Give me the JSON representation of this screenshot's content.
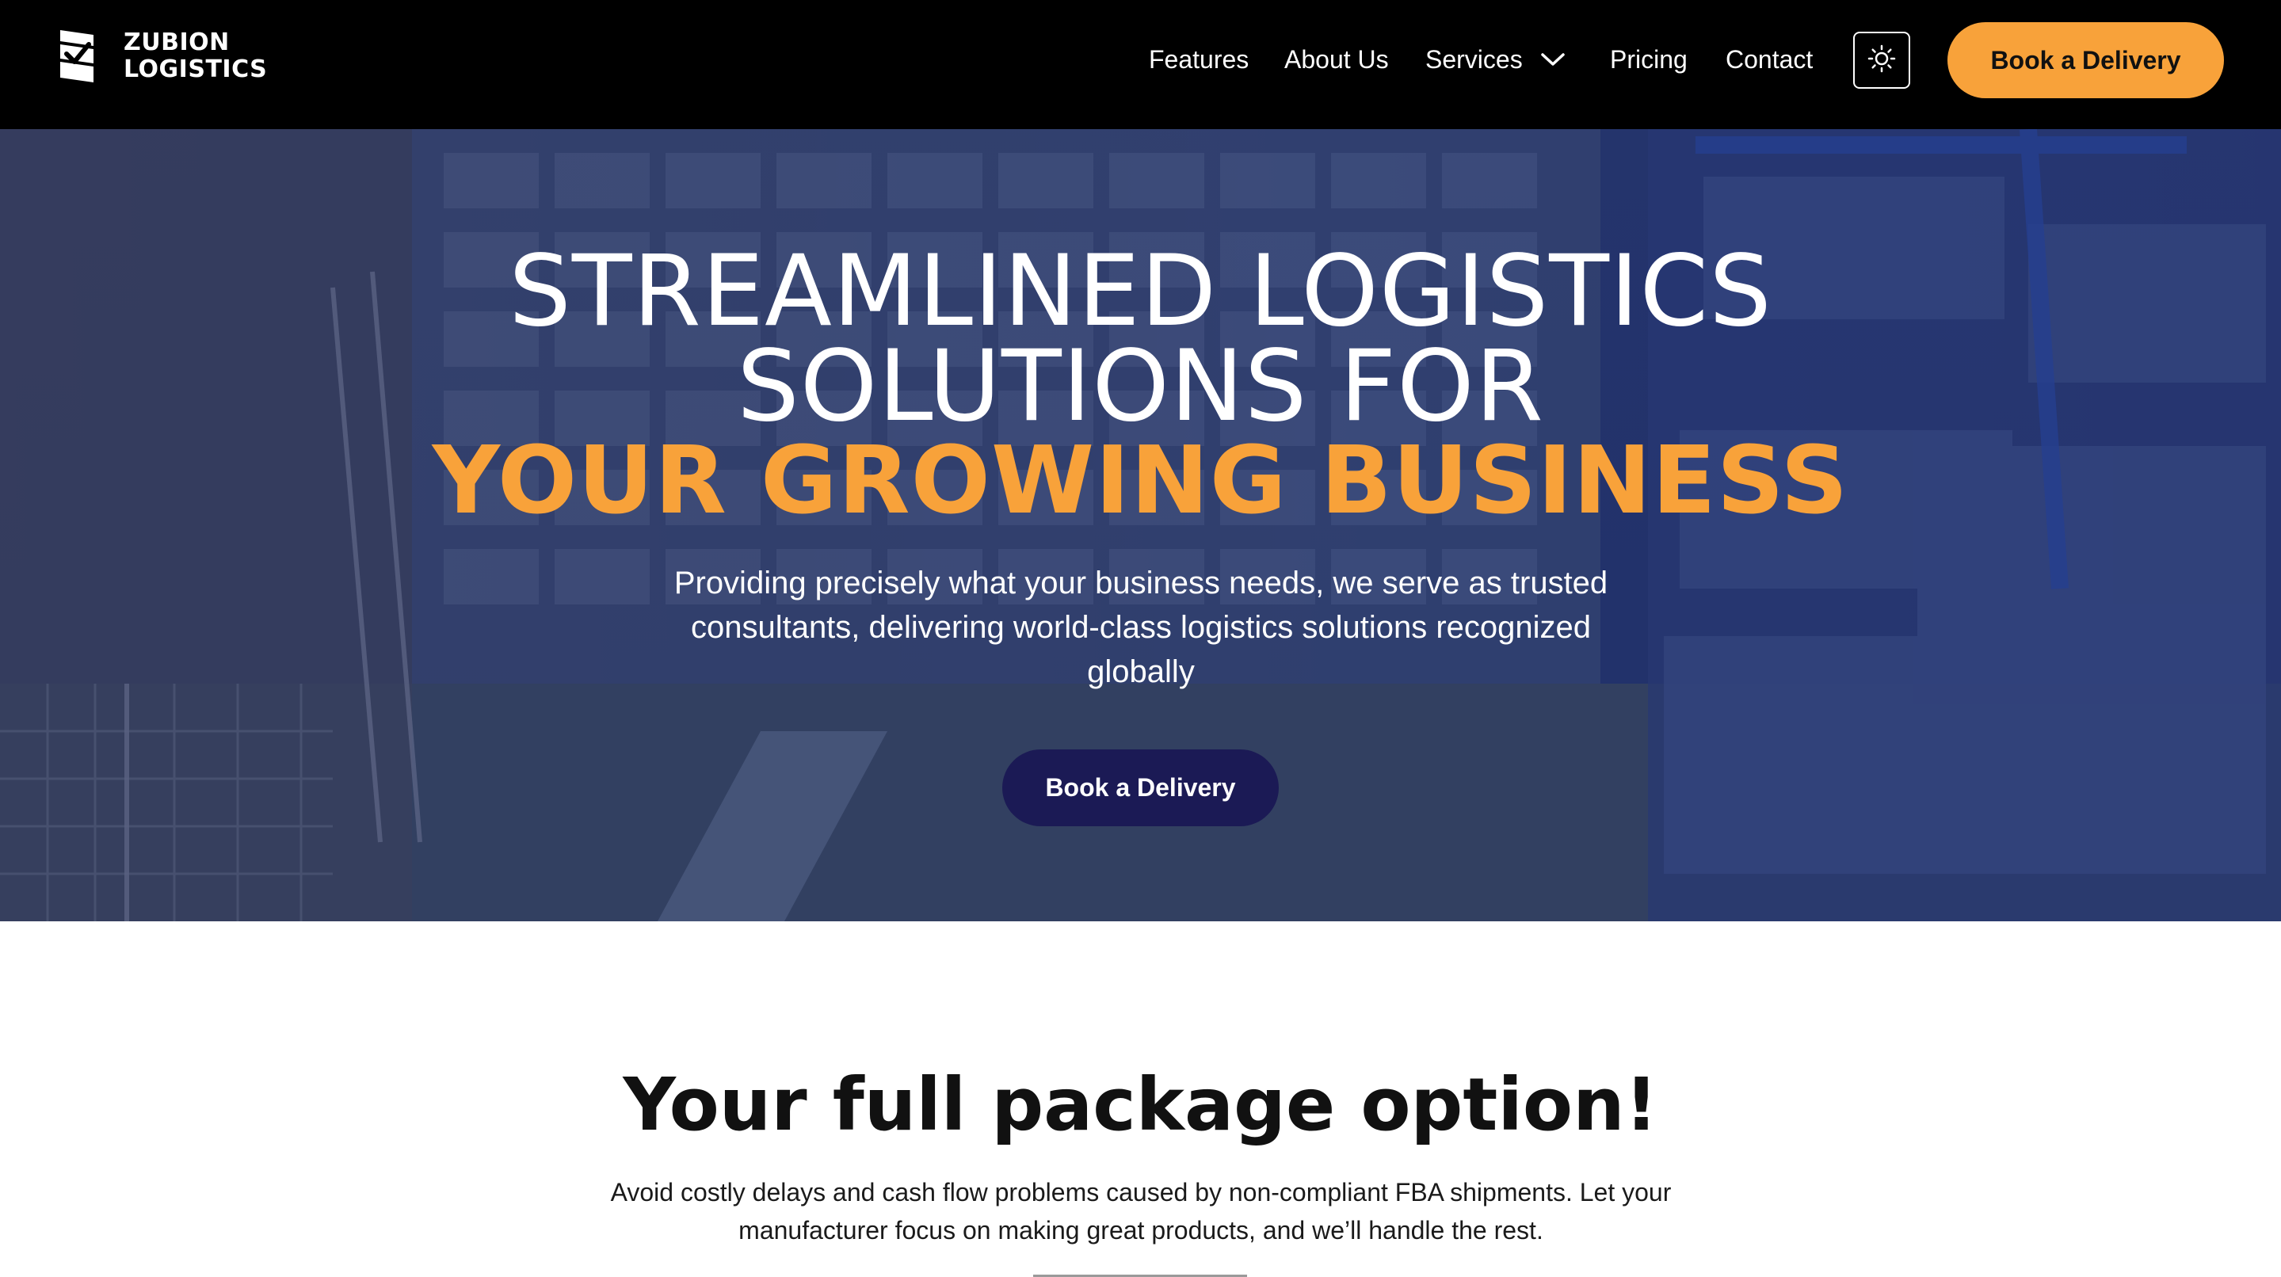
{
  "brand": {
    "name_line1": "ZUBION",
    "name_line2": "LOGISTICS",
    "logo_icon": "box-check-icon"
  },
  "nav": {
    "links": [
      {
        "label": "Features"
      },
      {
        "label": "About Us"
      },
      {
        "label": "Services"
      },
      {
        "label": "Pricing"
      },
      {
        "label": "Contact"
      }
    ],
    "services_icon": "chevron-down-icon",
    "theme_toggle_icon": "sun-icon",
    "cta_label": "Book a Delivery"
  },
  "hero": {
    "title_line1": "STREAMLINED LOGISTICS",
    "title_line2": "SOLUTIONS FOR",
    "title_highlight": "YOUR GROWING BUSINESS",
    "subtitle": "Providing precisely what your business needs, we serve as trusted consultants, delivering world-class logistics solutions recognized globally",
    "cta_label": "Book a Delivery",
    "background_image": "warehouse-photo"
  },
  "package_section": {
    "title": "Your full package option!",
    "description": "Avoid costly delays and cash flow problems caused by non-compliant FBA shipments. Let your manufacturer focus on making great products, and we’ll handle the rest."
  },
  "colors": {
    "nav_bg": "#000000",
    "accent_orange": "#f8a23a",
    "hero_button": "#1b1a55",
    "hero_overlay": "#232d64"
  }
}
